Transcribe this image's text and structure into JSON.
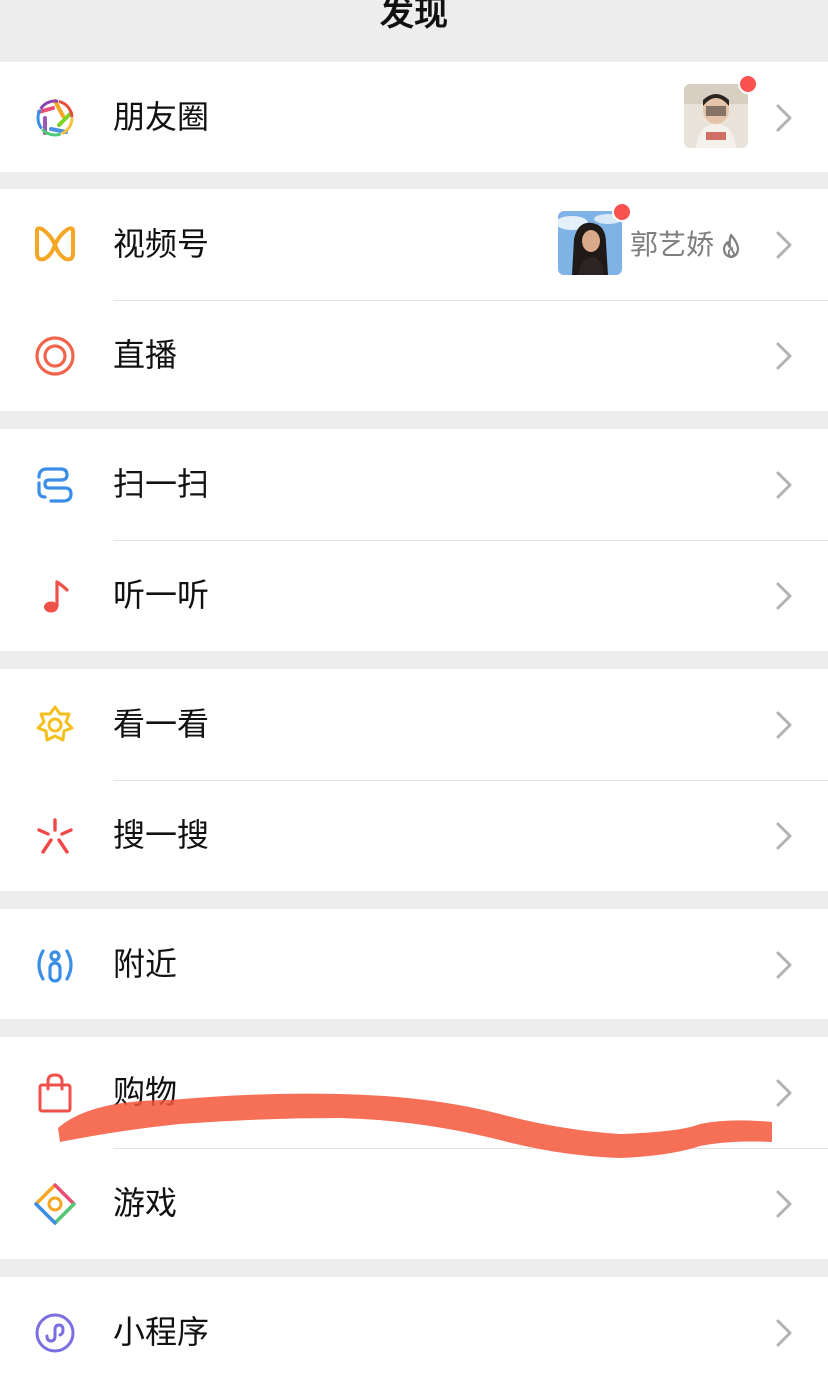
{
  "header": {
    "title": "发现"
  },
  "items": [
    {
      "label": "朋友圈",
      "icon": "moments-aperture-icon",
      "has_thumb": true,
      "has_red_dot": true
    },
    {
      "label": "视频号",
      "icon": "channels-butterfly-icon",
      "has_thumb": true,
      "has_red_dot": true,
      "author": "郭艺娇",
      "author_badge_icon": "flame-icon"
    },
    {
      "label": "直播",
      "icon": "live-broadcast-icon"
    },
    {
      "label": "扫一扫",
      "icon": "scan-icon"
    },
    {
      "label": "听一听",
      "icon": "music-note-icon"
    },
    {
      "label": "看一看",
      "icon": "top-stories-icon"
    },
    {
      "label": "搜一搜",
      "icon": "search-sparkle-icon"
    },
    {
      "label": "附近",
      "icon": "nearby-icon"
    },
    {
      "label": "购物",
      "icon": "shopping-bag-icon"
    },
    {
      "label": "游戏",
      "icon": "games-diamond-icon"
    },
    {
      "label": "小程序",
      "icon": "mini-programs-icon"
    }
  ],
  "colors": {
    "background": "#ededed",
    "cell": "#ffffff",
    "divider": "#e5e5e5",
    "chevron": "#b2b2b2",
    "red_dot": "#fa5151",
    "secondary_text": "#7f7f7f",
    "scribble": "#f4563a"
  },
  "overlay": {
    "type": "hand-drawn scribble over 购物 row"
  }
}
